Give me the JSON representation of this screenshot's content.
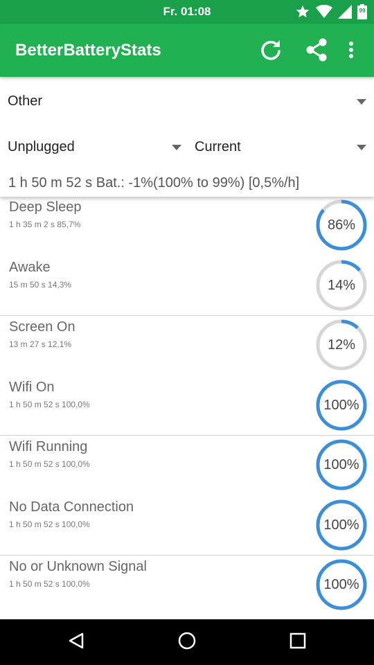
{
  "status_bar": {
    "time": "Fr. 01:08",
    "battery_level": "99",
    "icons": [
      "star-icon",
      "wifi-icon",
      "signal-icon",
      "battery-icon"
    ]
  },
  "app_bar": {
    "title": "BetterBatteryStats",
    "actions": [
      "refresh-icon",
      "share-icon",
      "overflow-menu-icon"
    ]
  },
  "filters": {
    "stat_type": "Other",
    "from_ref": "Unplugged",
    "to_ref": "Current",
    "summary": "1 h 50 m 52 s  Bat.: -1%(100% to 99%) [0,5%/h]"
  },
  "colors": {
    "status_bar": "#1aa04b",
    "app_bar": "#21b152",
    "ring_fill": "#3b8fd8",
    "ring_track": "#d6d6d6"
  },
  "items": [
    {
      "title": "Deep Sleep",
      "detail": "1 h 35 m 2 s  85,7%",
      "percent_label": "86%",
      "percent": 86
    },
    {
      "title": "Awake",
      "detail": "15 m 50 s  14,3%",
      "percent_label": "14%",
      "percent": 14
    },
    {
      "title": "Screen On",
      "detail": "13 m 27 s  12,1%",
      "percent_label": "12%",
      "percent": 12
    },
    {
      "title": "Wifi On",
      "detail": "1 h 50 m 52 s  100,0%",
      "percent_label": "100%",
      "percent": 100
    },
    {
      "title": "Wifi Running",
      "detail": "1 h 50 m 52 s  100,0%",
      "percent_label": "100%",
      "percent": 100
    },
    {
      "title": "No Data Connection",
      "detail": "1 h 50 m 52 s  100,0%",
      "percent_label": "100%",
      "percent": 100
    },
    {
      "title": "No or Unknown Signal",
      "detail": "1 h 50 m 52 s  100,0%",
      "percent_label": "100%",
      "percent": 100
    }
  ],
  "nav_bar": [
    "back-icon",
    "home-icon",
    "recents-icon"
  ]
}
